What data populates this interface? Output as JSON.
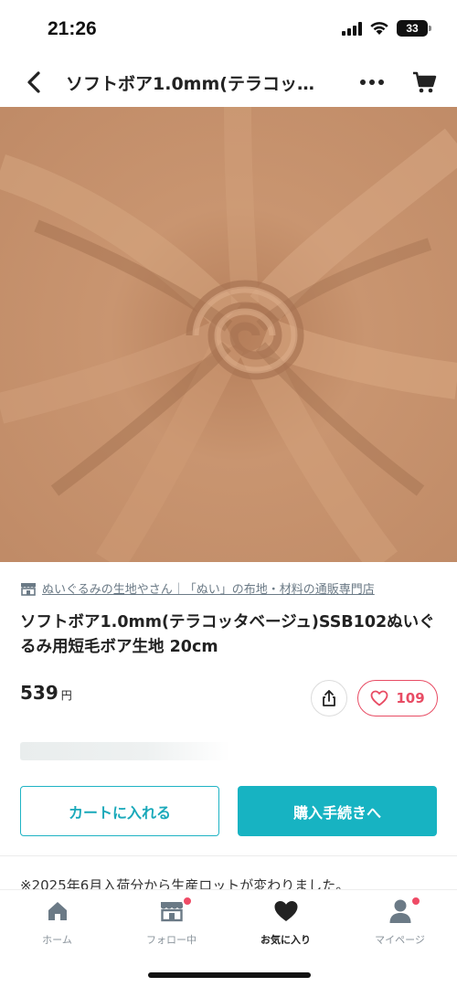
{
  "status_bar": {
    "time": "21:26",
    "battery": "33"
  },
  "nav": {
    "title": "ソフトボア1.0mm(テラコッ…",
    "back_icon": "chevron-left-icon",
    "more_icon": "more-horizontal-icon",
    "cart_icon": "shopping-cart-icon"
  },
  "product": {
    "image_alt": "swirled terracotta beige soft boa fabric",
    "shop_name": "ぬいぐるみの生地やさん｜「ぬい」の布地・材料の通販専門店",
    "title": "ソフトボア1.0mm(テラコッタベージュ)SSB102ぬいぐるみ用短毛ボア生地 20cm",
    "price": "539",
    "price_unit": "円",
    "like_count": "109"
  },
  "actions": {
    "add_to_cart": "カートに入れる",
    "checkout": "購入手続きへ"
  },
  "notice": "※2025年6月入荷分から生産ロットが変わりました。",
  "tab_bar": {
    "items": [
      {
        "label": "ホーム",
        "icon": "home-icon",
        "badge": false,
        "active": false
      },
      {
        "label": "フォロー中",
        "icon": "shop-icon",
        "badge": true,
        "active": false
      },
      {
        "label": "お気に入り",
        "icon": "heart-icon",
        "badge": false,
        "active": true
      },
      {
        "label": "マイページ",
        "icon": "person-icon",
        "badge": true,
        "active": false
      }
    ]
  },
  "colors": {
    "accent": "#17b3c2",
    "like": "#e84c64",
    "fabric": "#c4906a"
  }
}
